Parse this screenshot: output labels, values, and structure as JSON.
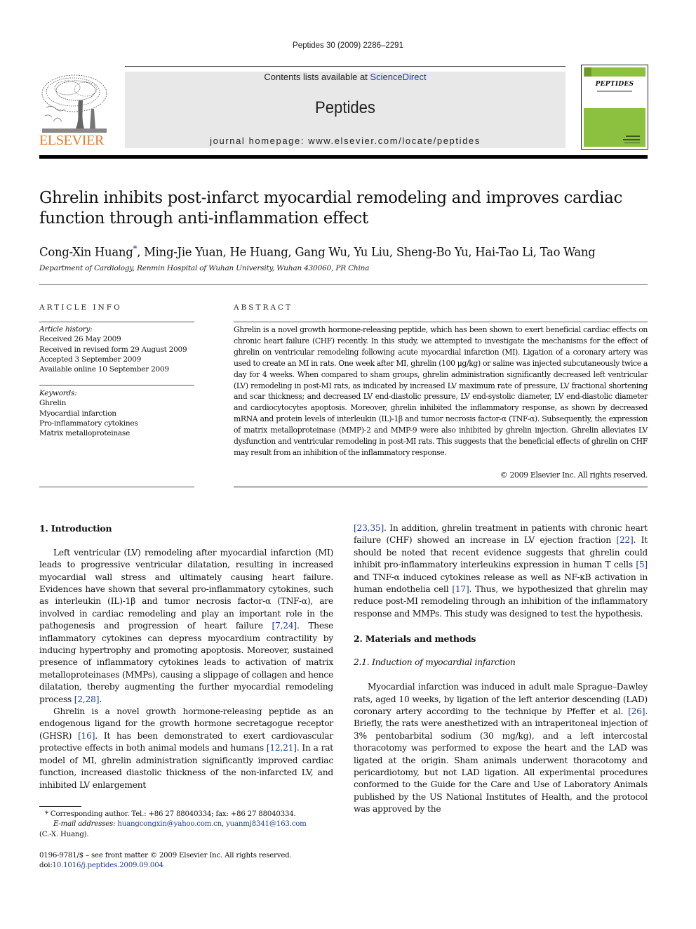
{
  "header": {
    "running_head": "Peptides 30 (2009) 2286–2291",
    "contents_prefix": "Contents lists available at ",
    "contents_link": "ScienceDirect",
    "journal_name": "Peptides",
    "homepage": "journal homepage: www.elsevier.com/locate/peptides",
    "publisher_logo_text": "ELSEVIER",
    "cover_title": "PEPTIDES"
  },
  "colors": {
    "elsevier_orange": "#e8782a",
    "cover_green": "#8cc13f",
    "link_blue": "#1f3c93",
    "banner_gray": "#e8e8e8"
  },
  "article": {
    "title": "Ghrelin inhibits post-infarct myocardial remodeling and improves cardiac function through anti-inflammation effect",
    "authors_first": "Cong-Xin Huang",
    "authors_star": "*",
    "authors_rest": ", Ming-Jie Yuan, He Huang, Gang Wu, Yu Liu, Sheng-Bo Yu, Hai-Tao Li, Tao Wang",
    "affiliation": "Department of Cardiology, Renmin Hospital of Wuhan University, Wuhan 430060, PR China"
  },
  "article_info": {
    "label": "ARTICLE INFO",
    "history_label": "Article history:",
    "history": [
      "Received 26 May 2009",
      "Received in revised form 29 August 2009",
      "Accepted 3 September 2009",
      "Available online 10 September 2009"
    ],
    "keywords_label": "Keywords:",
    "keywords": [
      "Ghrelin",
      "Myocardial infarction",
      "Pro-inflammatory cytokines",
      "Matrix metalloproteinase"
    ]
  },
  "abstract": {
    "label": "ABSTRACT",
    "text": "Ghrelin is a novel growth hormone-releasing peptide, which has been shown to exert beneficial cardiac effects on chronic heart failure (CHF) recently. In this study, we attempted to investigate the mechanisms for the effect of ghrelin on ventricular remodeling following acute myocardial infarction (MI). Ligation of a coronary artery was used to create an MI in rats. One week after MI, ghrelin (100 μg/kg) or saline was injected subcutaneously twice a day for 4 weeks. When compared to sham groups, ghrelin administration significantly decreased left ventricular (LV) remodeling in post-MI rats, as indicated by increased LV maximum rate of pressure, LV fractional shortening and scar thickness; and decreased LV end-diastolic pressure, LV end-systolic diameter, LV end-diastolic diameter and cardiocytocytes apoptosis. Moreover, ghrelin inhibited the inflammatory response, as shown by decreased mRNA and protein levels of interleukin (IL)-1β and tumor necrosis factor-α (TNF-α). Subsequently, the expression of matrix metalloproteinase (MMP)-2 and MMP-9 were also inhibited by ghrelin injection. Ghrelin alleviates LV dysfunction and ventricular remodeling in post-MI rats. This suggests that the beneficial effects of ghrelin on CHF may result from an inhibition of the inflammatory response.",
    "copyright": "© 2009 Elsevier Inc. All rights reserved."
  },
  "body": {
    "intro_heading": "1.  Introduction",
    "intro_p1_a": "Left ventricular (LV) remodeling after myocardial infarction (MI) leads to progressive ventricular dilatation, resulting in increased myocardial wall stress and ultimately causing heart failure. Evidences have shown that several pro-inflammatory cytokines, such as interleukin (IL)-1β and tumor necrosis factor-α (TNF-α), are involved in cardiac remodeling and play an important role in the pathogenesis and progression of heart failure ",
    "intro_p1_ref1": "[7,24]",
    "intro_p1_b": ". These inflammatory cytokines can depress myocardium contractility by inducing hypertrophy and promoting apoptosis. Moreover, sustained presence of inflammatory cytokines leads to activation of matrix metalloproteinases (MMPs), causing a slippage of collagen and hence dilatation, thereby augmenting the further myocardial remodeling process ",
    "intro_p1_ref2": "[2,28]",
    "intro_p1_c": ".",
    "intro_p2_a": "Ghrelin is a novel growth hormone-releasing peptide as an endogenous ligand for the growth hormone secretagogue receptor (GHSR) ",
    "intro_p2_ref1": "[16]",
    "intro_p2_b": ". It has been demonstrated to exert cardiovascular protective effects in both animal models and humans ",
    "intro_p2_ref2": "[12,21]",
    "intro_p2_c": ". In a rat model of MI, ghrelin administration significantly improved cardiac function, increased diastolic thickness of the non-infarcted LV, and inhibited LV enlargement ",
    "intro_p2_ref3": "[23,35]",
    "intro_p2_d": ". In addition, ghrelin treatment in patients with chronic heart failure (CHF) showed an increase in LV ejection fraction ",
    "intro_p2_ref4": "[22]",
    "intro_p2_e": ". It should be noted that recent evidence suggests that ghrelin could inhibit pro-inflammatory interleukins expression in human T cells ",
    "intro_p2_ref5": "[5]",
    "intro_p2_f": " and TNF-α induced cytokines release as well as NF-κB activation in human endothelia cell ",
    "intro_p2_ref6": "[17]",
    "intro_p2_g": ". Thus, we hypothesized that ghrelin may reduce post-MI remodeling through an inhibition of the inflammatory response and MMPs. This study was designed to test the hypothesis.",
    "methods_heading": "2.  Materials and methods",
    "methods_sub": "2.1.  Induction of myocardial infarction",
    "methods_p1_a": "Myocardial infarction was induced in adult male Sprague–Dawley rats, aged 10 weeks, by ligation of the left anterior descending (LAD) coronary artery according to the technique by Pfeffer et al. ",
    "methods_p1_ref": "[26]",
    "methods_p1_b": ". Briefly, the rats were anesthetized with an intraperitoneal injection of 3% pentobarbital sodium (30 mg/kg), and a left intercostal thoracotomy was performed to expose the heart and the LAD was ligated at the origin. Sham animals underwent thoracotomy and pericardiotomy, but not LAD ligation. All experimental procedures conformed to the Guide for the Care and Use of Laboratory Animals published by the US National Institutes of Health, and the protocol was approved by the"
  },
  "footnotes": {
    "corresponding": "* Corresponding author. Tel.: +86 27 88040334; fax: +86 27 88040334.",
    "email_label": "E-mail addresses: ",
    "email1": "huangcongxin@yahoo.com.cn",
    "email_sep": ", ",
    "email2": "yuanmj8341@163.com",
    "email_owner": "(C.-X. Huang).",
    "front_matter": "0196-9781/$ – see front matter © 2009 Elsevier Inc. All rights reserved.",
    "doi_prefix": "doi:",
    "doi": "10.1016/j.peptides.2009.09.004"
  }
}
